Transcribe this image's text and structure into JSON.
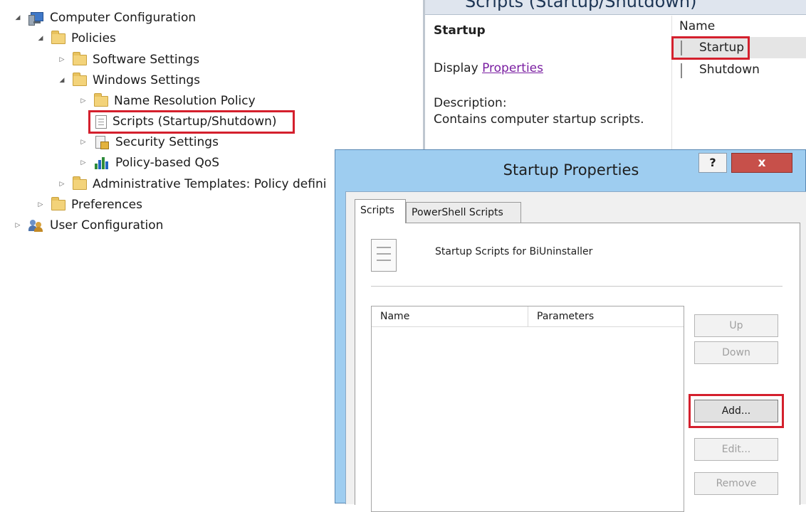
{
  "tree": {
    "items": [
      {
        "label": "Computer Configuration",
        "expander": "◢"
      },
      {
        "label": "Policies",
        "expander": "◢"
      },
      {
        "label": "Software Settings",
        "expander": "▷"
      },
      {
        "label": "Windows Settings",
        "expander": "◢"
      },
      {
        "label": "Name Resolution Policy",
        "expander": "▷"
      },
      {
        "label": "Scripts (Startup/Shutdown)",
        "expander": ""
      },
      {
        "label": "Security Settings",
        "expander": "▷"
      },
      {
        "label": "Policy-based QoS",
        "expander": "▷"
      },
      {
        "label": "Administrative Templates: Policy defini",
        "expander": "▷"
      },
      {
        "label": "Preferences",
        "expander": "▷"
      },
      {
        "label": "User Configuration",
        "expander": "▷"
      }
    ]
  },
  "right_pane": {
    "header_title": "Scripts (Startup/Shutdown)",
    "section_title": "Startup",
    "display_prefix": "Display",
    "properties_link": "Properties",
    "description_label": "Description:",
    "description_text": "Contains computer startup scripts.",
    "list_header": "Name",
    "list_items": [
      "Startup",
      "Shutdown"
    ]
  },
  "dialog": {
    "title": "Startup Properties",
    "help_label": "?",
    "close_label": "x",
    "tabs": [
      "Scripts",
      "PowerShell Scripts"
    ],
    "panel_title": "Startup Scripts for BiUninstaller",
    "columns": [
      "Name",
      "Parameters"
    ],
    "buttons": {
      "up": "Up",
      "down": "Down",
      "add": "Add...",
      "edit": "Edit...",
      "remove": "Remove"
    }
  },
  "colors": {
    "highlight": "#d4202d",
    "link": "#7a1ea1",
    "dialog_frame": "#9ecdf0",
    "close_button": "#c7504a"
  }
}
